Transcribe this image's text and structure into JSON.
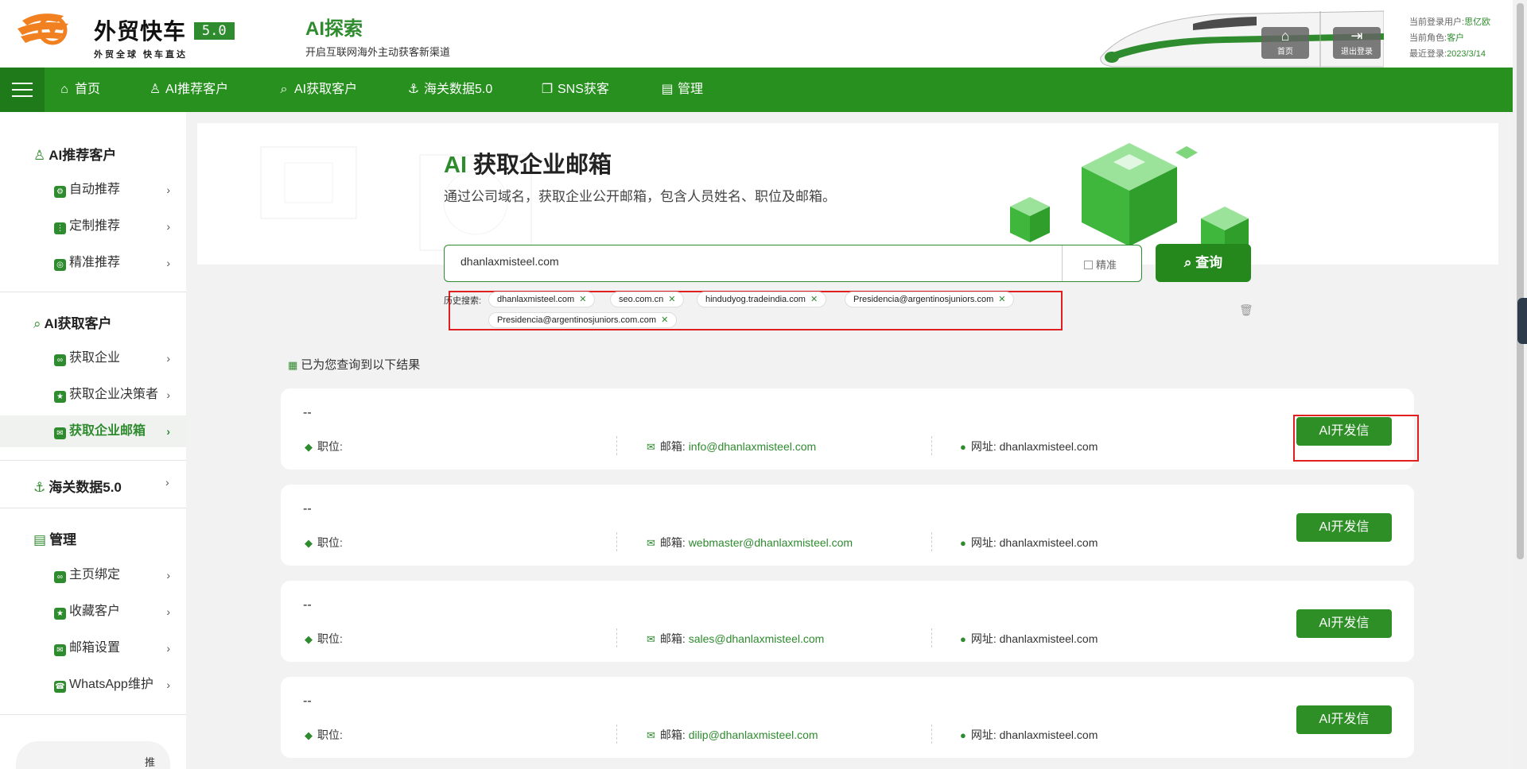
{
  "header": {
    "brand_name": "外贸快车",
    "version": "5.0",
    "slogan": "外贸全球 快车直达",
    "module_title": "AI探索",
    "module_subtitle": "开启互联网海外主动获客新渠道",
    "home_label": "首页",
    "logout_label": "退出登录",
    "user_label": "当前登录用户:",
    "user_value": "思亿欧",
    "role_label": "当前角色:",
    "role_value": "客户",
    "last_login_label": "最近登录:",
    "last_login_value": "2023/3/14"
  },
  "nav": {
    "items": [
      {
        "label": "首页",
        "icon": "home-icon"
      },
      {
        "label": "AI推荐客户",
        "icon": "user-icon"
      },
      {
        "label": "AI获取客户",
        "icon": "search-icon"
      },
      {
        "label": "海关数据5.0",
        "icon": "anchor-icon"
      },
      {
        "label": "SNS获客",
        "icon": "chat-icon"
      },
      {
        "label": "管理",
        "icon": "document-icon"
      }
    ]
  },
  "sidebar": {
    "groups": [
      {
        "title": "AI推荐客户",
        "items": [
          "自动推荐",
          "定制推荐",
          "精准推荐"
        ]
      },
      {
        "title": "AI获取客户",
        "items": [
          "获取企业",
          "获取企业决策者",
          "获取企业邮箱"
        ]
      },
      {
        "title": "海关数据5.0",
        "items": []
      },
      {
        "title": "管理",
        "items": [
          "主页绑定",
          "收藏客户",
          "邮箱设置",
          "WhatsApp维护"
        ]
      }
    ],
    "active_item": "获取企业邮箱",
    "bottom_text": "推"
  },
  "main": {
    "title_ai": "AI",
    "title_rest": " 获取企业邮箱",
    "description": "通过公司域名，获取企业公开邮箱，包含人员姓名、职位及邮箱。",
    "search_value": "dhanlaxmisteel.com",
    "precise_label": "精准",
    "search_button": "查询",
    "history_label": "历史搜索:",
    "history": [
      "dhanlaxmisteel.com",
      "seo.com.cn",
      "hindudyog.tradeindia.com",
      "Presidencia@argentinosjuniors.com",
      "Presidencia@argentinosjuniors.com.com"
    ],
    "result_heading": "已为您查询到以下结果",
    "position_label": "职位:",
    "email_label": "邮箱:",
    "website_label": "网址:",
    "ai_button_label": "AI开发信",
    "results": [
      {
        "name": "--",
        "position": "",
        "email": "info@dhanlaxmisteel.com",
        "website": "dhanlaxmisteel.com"
      },
      {
        "name": "--",
        "position": "",
        "email": "webmaster@dhanlaxmisteel.com",
        "website": "dhanlaxmisteel.com"
      },
      {
        "name": "--",
        "position": "",
        "email": "sales@dhanlaxmisteel.com",
        "website": "dhanlaxmisteel.com"
      },
      {
        "name": "--",
        "position": "",
        "email": "dilip@dhanlaxmisteel.com",
        "website": "dhanlaxmisteel.com"
      }
    ]
  },
  "colors": {
    "brand_green": "#27901f",
    "highlight_red": "#e02020",
    "logo_orange": "#f08020"
  }
}
